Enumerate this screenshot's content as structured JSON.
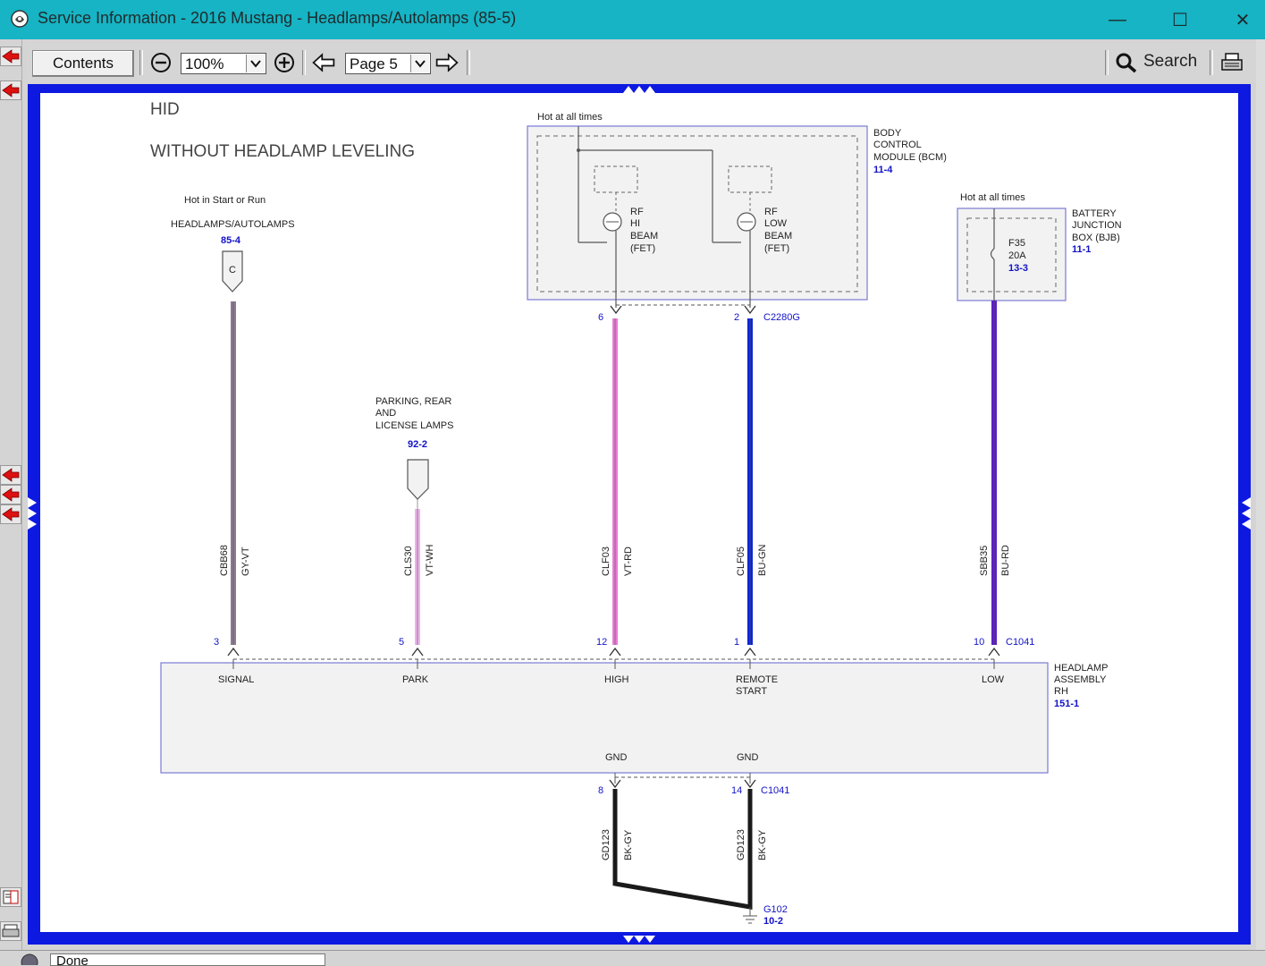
{
  "window": {
    "title": "Service Information - 2016 Mustang - Headlamps/Autolamps (85-5)",
    "minimize_glyph": "—",
    "maximize_glyph": "☐",
    "close_glyph": "✕"
  },
  "toolbar": {
    "contents_label": "Contents",
    "zoom_value": "100%",
    "page_value": "Page 5",
    "search_label": "Search",
    "icons": [
      "zoom-out-icon",
      "zoom-in-icon",
      "previous-page-icon",
      "next-page-icon",
      "search-icon",
      "print-icon"
    ]
  },
  "status": {
    "text": "Done"
  },
  "colors": {
    "titlebar": "#16b4c4",
    "frame": "#0d19e0",
    "wire_gy_vt": "#8d7a94",
    "wire_vt_wh": "#eeb2ec",
    "wire_vt_rd": "#ea7bd6",
    "wire_blu_gn": "#0d25d6",
    "wire_blu_rd": "#5a1fc4",
    "wire_bk_gy": "#1a1a1a",
    "link_blue": "#1212c8"
  },
  "diagram": {
    "heading": "HID",
    "subheading": "WITHOUT HEADLAMP LEVELING",
    "hot_start_run": "Hot in Start or Run",
    "hot_all_times": "Hot at all times",
    "hot_all_times_bjb": "Hot at all times",
    "ref_headlamps": {
      "label": "HEADLAMPS/AUTOLAMPS",
      "page": "85-4",
      "connector": "C"
    },
    "ref_parking": {
      "lines": [
        "PARKING, REAR",
        "AND",
        "LICENSE LAMPS"
      ],
      "page": "92-2"
    },
    "bcm": {
      "lines": [
        "BODY",
        "CONTROL",
        "MODULE (BCM)"
      ],
      "page": "11-4"
    },
    "rf_hi": [
      "RF",
      "HI",
      "BEAM",
      "(FET)"
    ],
    "rf_low": [
      "RF",
      "LOW",
      "BEAM",
      "(FET)"
    ],
    "bjb": {
      "lines": [
        "BATTERY",
        "JUNCTION",
        "BOX (BJB)"
      ],
      "page": "11-1",
      "fuse": "F35",
      "amps": "20A",
      "fuse_page": "13-3"
    },
    "connector_bcm": "C2280G",
    "connector_lamp": "C1041",
    "connector_gnd": "C1041",
    "bcm_pins": [
      "6",
      "2"
    ],
    "wires": [
      {
        "circuit": "CBB68",
        "color": "GY-VT",
        "pin": "3",
        "terminal": "SIGNAL"
      },
      {
        "circuit": "CLS30",
        "color": "VT-WH",
        "pin": "5",
        "terminal": "PARK"
      },
      {
        "circuit": "CLF03",
        "color": "VT-RD",
        "pin": "12",
        "terminal": "HIGH"
      },
      {
        "circuit": "CLF05",
        "color": "BU-GN",
        "pin": "1",
        "terminal": "REMOTE START"
      },
      {
        "circuit": "SBB35",
        "color": "BU-RD",
        "pin": "10",
        "terminal": "LOW"
      }
    ],
    "headlamp_assembly": {
      "lines": [
        "HEADLAMP",
        "ASSEMBLY",
        "RH"
      ],
      "page": "151-1"
    },
    "remote_start_lines": [
      "REMOTE",
      "START"
    ],
    "ground_terminals": [
      "GND",
      "GND"
    ],
    "ground_wires": [
      {
        "circuit": "GD123",
        "color": "BK-GY",
        "pin": "8"
      },
      {
        "circuit": "GD123",
        "color": "BK-GY",
        "pin": "14"
      }
    ],
    "ground_point": {
      "name": "G102",
      "page": "10-2"
    }
  }
}
